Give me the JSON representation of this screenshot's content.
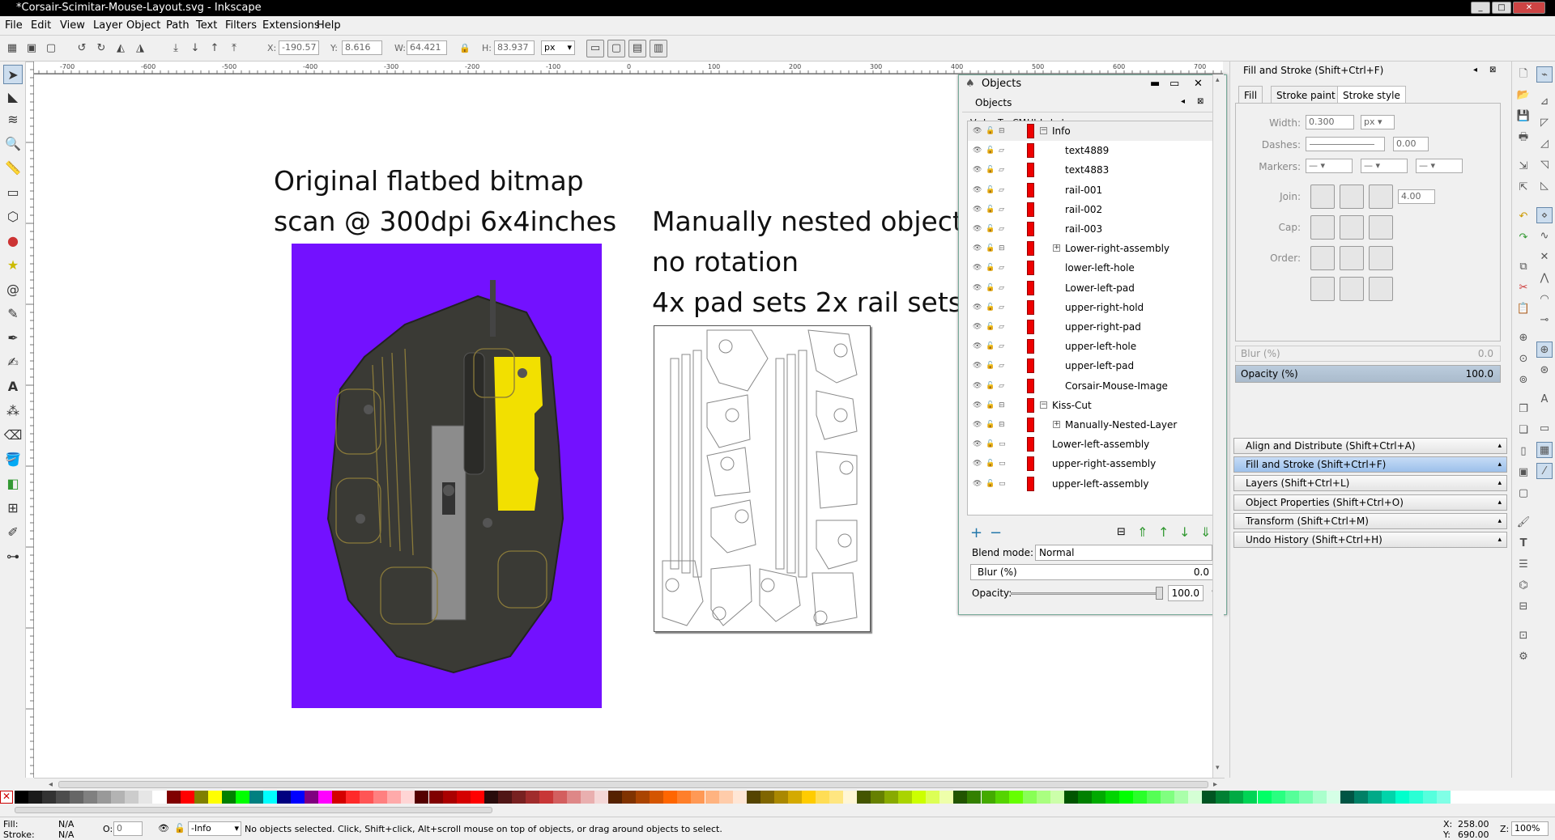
{
  "window": {
    "title": "*Corsair-Scimitar-Mouse-Layout.svg - Inkscape"
  },
  "menu": [
    "File",
    "Edit",
    "View",
    "Layer",
    "Object",
    "Path",
    "Text",
    "Filters",
    "Extensions",
    "Help"
  ],
  "cmd": {
    "x_label": "X:",
    "x": "-190.57",
    "y_label": "Y:",
    "y": "8.616",
    "w_label": "W:",
    "w": "64.421",
    "h_label": "H:",
    "h": "83.937",
    "unit": "px"
  },
  "ruler": {
    "h": [
      "-700",
      "-600",
      "-500",
      "-400",
      "-300",
      "-200",
      "-100",
      "0",
      "100",
      "200",
      "300",
      "400",
      "500",
      "600",
      "700"
    ],
    "v": [
      "400",
      "300",
      "200",
      "100",
      "0",
      "-100",
      "-200",
      "-300",
      "-400",
      "-500",
      "-600"
    ]
  },
  "canvas": {
    "left_title_1": "Original flatbed bitmap",
    "left_title_2": "scan @ 300dpi 6x4inches",
    "right_title_1": "Manually nested object",
    "right_title_2": "no rotation",
    "right_title_3": "4x pad sets 2x rail sets"
  },
  "objects": {
    "window_title": "Objects",
    "panel_title": "Objects",
    "columns": {
      "v": "V",
      "l": "L",
      "t": "T",
      "cm": "CM",
      "hl": "HL",
      "label": "Label"
    },
    "rows": [
      {
        "label": "Info",
        "indent": 0,
        "expander": "⊟"
      },
      {
        "label": "text4889",
        "indent": 1,
        "expander": ""
      },
      {
        "label": "text4883",
        "indent": 1,
        "expander": ""
      },
      {
        "label": "rail-001",
        "indent": 1,
        "expander": ""
      },
      {
        "label": "rail-002",
        "indent": 1,
        "expander": ""
      },
      {
        "label": "rail-003",
        "indent": 1,
        "expander": ""
      },
      {
        "label": "Lower-right-assembly",
        "indent": 1,
        "expander": "⊞"
      },
      {
        "label": "lower-left-hole",
        "indent": 1,
        "expander": ""
      },
      {
        "label": "Lower-left-pad",
        "indent": 1,
        "expander": ""
      },
      {
        "label": "upper-right-hold",
        "indent": 1,
        "expander": ""
      },
      {
        "label": "upper-right-pad",
        "indent": 1,
        "expander": ""
      },
      {
        "label": "upper-left-hole",
        "indent": 1,
        "expander": ""
      },
      {
        "label": "upper-left-pad",
        "indent": 1,
        "expander": ""
      },
      {
        "label": "Corsair-Mouse-Image",
        "indent": 1,
        "expander": ""
      },
      {
        "label": "Kiss-Cut",
        "indent": 0,
        "expander": "⊟"
      },
      {
        "label": "Manually-Nested-Layer",
        "indent": 1,
        "expander": "⊞"
      },
      {
        "label": "Lower-left-assembly",
        "indent": 0,
        "expander": ""
      },
      {
        "label": "upper-right-assembly",
        "indent": 0,
        "expander": ""
      },
      {
        "label": "upper-left-assembly",
        "indent": 0,
        "expander": ""
      }
    ],
    "blend_label": "Blend mode:",
    "blend_value": "Normal",
    "blur_label": "Blur (%)",
    "blur_value": "0.0",
    "opacity_label": "Opacity:",
    "opacity_value": "100.0",
    "opacity_unit": "%"
  },
  "fillstroke": {
    "title": "Fill and Stroke (Shift+Ctrl+F)",
    "tabs": [
      "Fill",
      "Stroke paint",
      "Stroke style"
    ],
    "width_label": "Width:",
    "width_value": "0.300",
    "width_unit": "px",
    "dashes_label": "Dashes:",
    "dashes_value": "0.00",
    "markers_label": "Markers:",
    "join_label": "Join:",
    "join_value": "4.00",
    "cap_label": "Cap:",
    "order_label": "Order:",
    "blur_label": "Blur (%)",
    "blur_value": "0.0",
    "opacity_label": "Opacity (%)",
    "opacity_value": "100.0"
  },
  "dock": [
    {
      "label": "Align and Distribute (Shift+Ctrl+A)",
      "selected": false
    },
    {
      "label": "Fill and Stroke (Shift+Ctrl+F)",
      "selected": true
    },
    {
      "label": "Layers (Shift+Ctrl+L)",
      "selected": false
    },
    {
      "label": "Object Properties (Shift+Ctrl+O)",
      "selected": false
    },
    {
      "label": "Transform (Shift+Ctrl+M)",
      "selected": false
    },
    {
      "label": "Undo History (Shift+Ctrl+H)",
      "selected": false
    }
  ],
  "status": {
    "fill_label": "Fill:",
    "fill_value": "N/A",
    "stroke_label": "Stroke:",
    "stroke_value": "N/A",
    "o_label": "O:",
    "o_value": "0",
    "layer": "-Info",
    "message": "No objects selected. Click, Shift+click, Alt+scroll mouse on top of objects, or drag around objects to select.",
    "x_label": "X:",
    "x_value": "258.00",
    "y_label": "Y:",
    "y_value": "690.00",
    "z_label": "Z:",
    "zoom": "100%"
  },
  "colors": {
    "scan_bg": "#7311ff",
    "hl": "#e00000",
    "accent": "#9cc0ea"
  }
}
